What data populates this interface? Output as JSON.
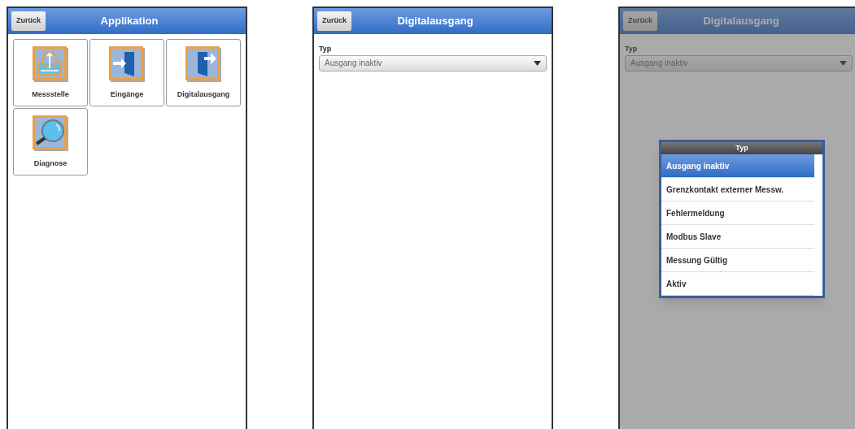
{
  "screens": [
    {
      "kind": "menu",
      "back_button": "Zurück",
      "title": "Applikation",
      "tiles": [
        {
          "label": "Messstelle"
        },
        {
          "label": "Eingänge"
        },
        {
          "label": "Digitalausgang"
        },
        {
          "label": "Diagnose"
        }
      ]
    },
    {
      "kind": "form",
      "dimmed": false,
      "back_button": "Zurück",
      "title": "Digitalausgang",
      "field": {
        "label": "Typ",
        "value": "Ausgang inaktiv"
      }
    },
    {
      "kind": "form",
      "dimmed": true,
      "back_button": "Zurück",
      "title": "Digitalausgang",
      "field": {
        "label": "Typ",
        "value": "Ausgang inaktiv"
      },
      "picker": {
        "title": "Typ",
        "options": [
          {
            "label": "Ausgang inaktiv",
            "selected": true
          },
          {
            "label": "Grenzkontakt externer Messw.",
            "selected": false
          },
          {
            "label": "Fehlermeldung",
            "selected": false
          },
          {
            "label": "Modbus Slave",
            "selected": false
          },
          {
            "label": "Messung Gültig",
            "selected": false
          },
          {
            "label": "Aktiv",
            "selected": false
          }
        ]
      }
    }
  ]
}
